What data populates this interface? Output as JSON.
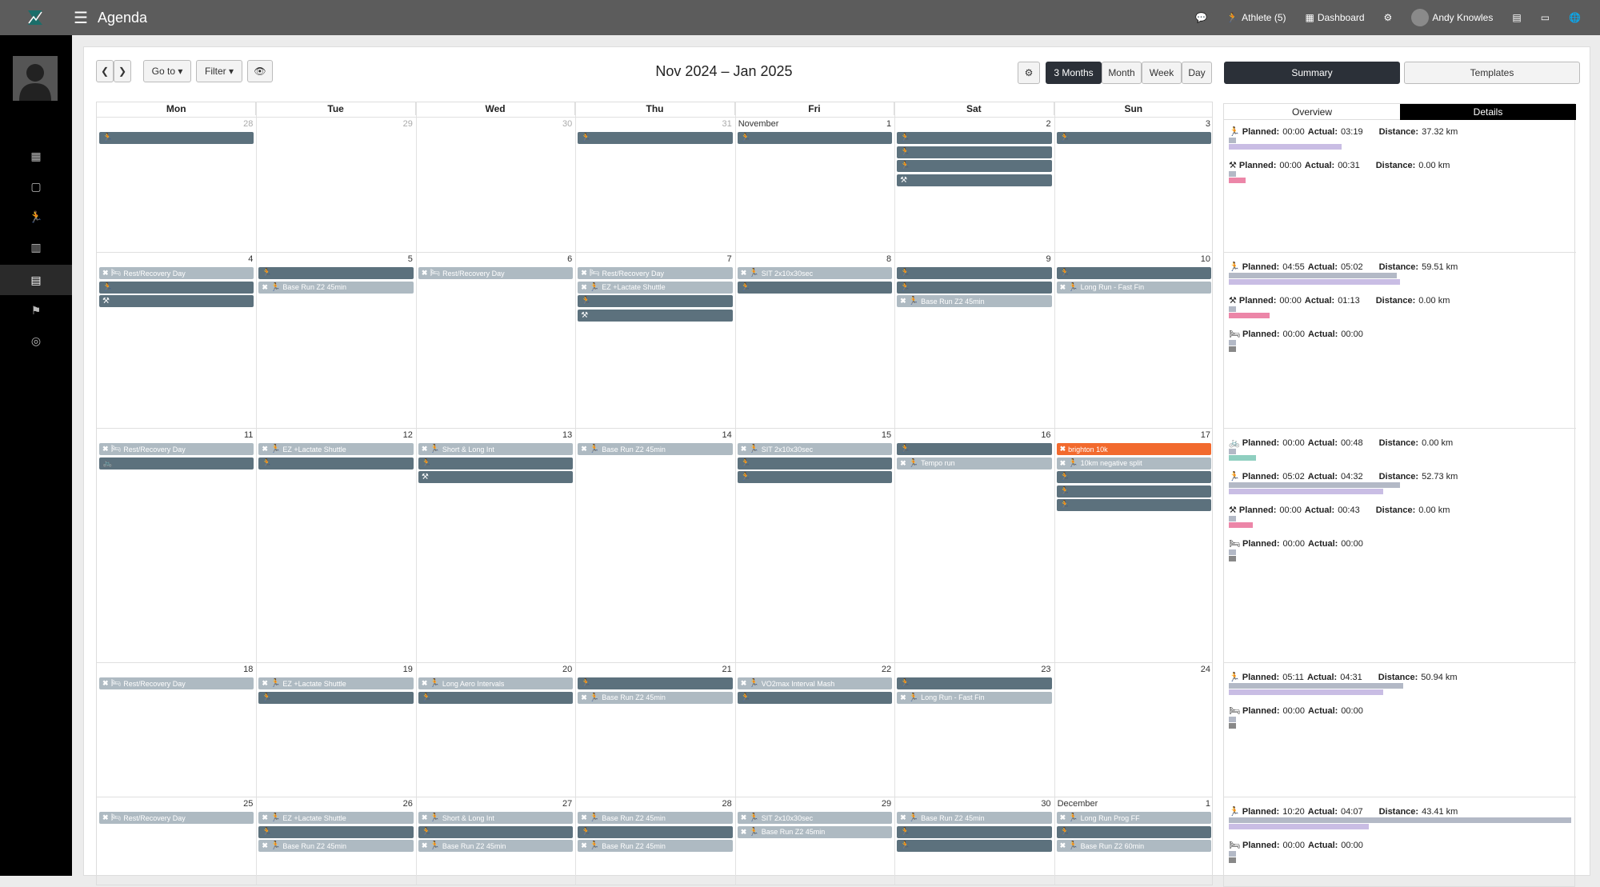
{
  "app": {
    "title": "Agenda"
  },
  "topbar": {
    "athlete": "Athlete (5)",
    "dashboard": "Dashboard",
    "user": "Andy Knowles"
  },
  "toolbar": {
    "goto": "Go to",
    "filter": "Filter",
    "title": "Nov 2024 – Jan 2025",
    "views": [
      "3 Months",
      "Month",
      "Week",
      "Day"
    ],
    "active_view": "3 Months"
  },
  "panel_tabs": {
    "summary": "Summary",
    "templates": "Templates",
    "overview": "Overview",
    "details": "Details"
  },
  "weekdays": [
    "Mon",
    "Tue",
    "Wed",
    "Thu",
    "Fri",
    "Sat",
    "Sun"
  ],
  "month_labels": {
    "nov": "November",
    "dec": "December"
  },
  "weeks": [
    {
      "days": [
        "28",
        "29",
        "30",
        "31",
        "1",
        "2",
        "3"
      ],
      "muted": [
        true,
        true,
        true,
        true,
        false,
        false,
        false
      ],
      "events": [
        {
          "col": 0,
          "row": 0,
          "style": "d",
          "icon": "run",
          "label": ""
        },
        {
          "col": 3,
          "row": 0,
          "style": "d",
          "icon": "run",
          "label": ""
        },
        {
          "col": 4,
          "row": 0,
          "style": "d",
          "icon": "run",
          "label": ""
        },
        {
          "col": 5,
          "row": 0,
          "style": "d",
          "icon": "run",
          "label": ""
        },
        {
          "col": 5,
          "row": 1,
          "style": "d",
          "icon": "run",
          "label": ""
        },
        {
          "col": 5,
          "row": 2,
          "style": "d",
          "icon": "run",
          "label": ""
        },
        {
          "col": 5,
          "row": 3,
          "style": "d",
          "icon": "strength",
          "label": ""
        },
        {
          "col": 6,
          "row": 0,
          "style": "d",
          "icon": "run",
          "label": ""
        }
      ]
    },
    {
      "days": [
        "4",
        "5",
        "6",
        "7",
        "8",
        "9",
        "10"
      ],
      "muted": [
        false,
        false,
        false,
        false,
        false,
        false,
        false
      ],
      "events": [
        {
          "col": 0,
          "row": 0,
          "style": "l",
          "icon": "rest",
          "label": "Rest/Recovery Day",
          "x": true
        },
        {
          "col": 0,
          "row": 1,
          "style": "d",
          "icon": "run",
          "label": ""
        },
        {
          "col": 0,
          "row": 2,
          "style": "d",
          "icon": "strength",
          "label": ""
        },
        {
          "col": 1,
          "row": 0,
          "style": "d",
          "icon": "run",
          "label": ""
        },
        {
          "col": 1,
          "row": 1,
          "style": "l",
          "icon": "run",
          "label": "Base Run Z2 45min",
          "x": true
        },
        {
          "col": 2,
          "row": 0,
          "style": "l",
          "icon": "rest",
          "label": "Rest/Recovery Day",
          "x": true
        },
        {
          "col": 3,
          "row": 0,
          "style": "l",
          "icon": "rest",
          "label": "Rest/Recovery Day",
          "x": true
        },
        {
          "col": 3,
          "row": 1,
          "style": "l",
          "icon": "run",
          "label": "EZ +Lactate Shuttle",
          "x": true
        },
        {
          "col": 3,
          "row": 2,
          "style": "d",
          "icon": "run",
          "label": ""
        },
        {
          "col": 3,
          "row": 3,
          "style": "d",
          "icon": "strength",
          "label": ""
        },
        {
          "col": 4,
          "row": 0,
          "style": "l",
          "icon": "run",
          "label": "SIT 2x10x30sec",
          "x": true
        },
        {
          "col": 4,
          "row": 1,
          "style": "d",
          "icon": "run",
          "label": ""
        },
        {
          "col": 5,
          "row": 0,
          "style": "d",
          "icon": "run",
          "label": ""
        },
        {
          "col": 5,
          "row": 1,
          "style": "d",
          "icon": "run",
          "label": ""
        },
        {
          "col": 5,
          "row": 2,
          "style": "l",
          "icon": "run",
          "label": "Base Run Z2 45min",
          "x": true
        },
        {
          "col": 6,
          "row": 0,
          "style": "d",
          "icon": "run",
          "label": ""
        },
        {
          "col": 6,
          "row": 1,
          "style": "l",
          "icon": "run",
          "label": "Long Run - Fast Fin",
          "x": true
        }
      ]
    },
    {
      "days": [
        "11",
        "12",
        "13",
        "14",
        "15",
        "16",
        "17"
      ],
      "muted": [
        false,
        false,
        false,
        false,
        false,
        false,
        false
      ],
      "events": [
        {
          "col": 0,
          "row": 0,
          "style": "l",
          "icon": "rest",
          "label": "Rest/Recovery Day",
          "x": true
        },
        {
          "col": 0,
          "row": 1,
          "style": "d",
          "icon": "bike",
          "label": ""
        },
        {
          "col": 1,
          "row": 0,
          "style": "l",
          "icon": "run",
          "label": "EZ +Lactate Shuttle",
          "x": true
        },
        {
          "col": 1,
          "row": 1,
          "style": "d",
          "icon": "run",
          "label": ""
        },
        {
          "col": 2,
          "row": 0,
          "style": "l",
          "icon": "run",
          "label": "Short & Long Int",
          "x": true
        },
        {
          "col": 2,
          "row": 1,
          "style": "d",
          "icon": "run",
          "label": ""
        },
        {
          "col": 2,
          "row": 2,
          "style": "d",
          "icon": "strength",
          "label": ""
        },
        {
          "col": 3,
          "row": 0,
          "style": "l",
          "icon": "run",
          "label": "Base Run Z2 45min",
          "x": true
        },
        {
          "col": 4,
          "row": 0,
          "style": "l",
          "icon": "run",
          "label": "SIT 2x10x30sec",
          "x": true
        },
        {
          "col": 4,
          "row": 1,
          "style": "d",
          "icon": "run",
          "label": ""
        },
        {
          "col": 4,
          "row": 2,
          "style": "d",
          "icon": "run",
          "label": ""
        },
        {
          "col": 5,
          "row": 0,
          "style": "d",
          "icon": "run",
          "label": ""
        },
        {
          "col": 5,
          "row": 1,
          "style": "l",
          "icon": "run",
          "label": "Tempo run",
          "x": true
        },
        {
          "col": 6,
          "row": 0,
          "style": "o",
          "icon": "",
          "label": "brighton 10k",
          "x": true
        },
        {
          "col": 6,
          "row": 1,
          "style": "l",
          "icon": "run",
          "label": "10km negative split",
          "x": true
        },
        {
          "col": 6,
          "row": 2,
          "style": "d",
          "icon": "run",
          "label": ""
        },
        {
          "col": 6,
          "row": 3,
          "style": "d",
          "icon": "run",
          "label": ""
        },
        {
          "col": 6,
          "row": 4,
          "style": "d",
          "icon": "run",
          "label": ""
        }
      ]
    },
    {
      "days": [
        "18",
        "19",
        "20",
        "21",
        "22",
        "23",
        "24"
      ],
      "muted": [
        false,
        false,
        false,
        false,
        false,
        false,
        false
      ],
      "events": [
        {
          "col": 0,
          "row": 0,
          "style": "l",
          "icon": "rest",
          "label": "Rest/Recovery Day",
          "x": true
        },
        {
          "col": 1,
          "row": 0,
          "style": "l",
          "icon": "run",
          "label": "EZ +Lactate Shuttle",
          "x": true
        },
        {
          "col": 1,
          "row": 1,
          "style": "d",
          "icon": "run",
          "label": ""
        },
        {
          "col": 2,
          "row": 0,
          "style": "l",
          "icon": "run",
          "label": "Long Aero Intervals",
          "x": true
        },
        {
          "col": 2,
          "row": 1,
          "style": "d",
          "icon": "run",
          "label": ""
        },
        {
          "col": 3,
          "row": 0,
          "style": "d",
          "icon": "run",
          "label": ""
        },
        {
          "col": 3,
          "row": 1,
          "style": "l",
          "icon": "run",
          "label": "Base Run Z2 45min",
          "x": true
        },
        {
          "col": 4,
          "row": 0,
          "style": "l",
          "icon": "run",
          "label": "VO2max Interval Mash",
          "x": true
        },
        {
          "col": 4,
          "row": 1,
          "style": "d",
          "icon": "run",
          "label": ""
        },
        {
          "col": 5,
          "row": 0,
          "style": "d",
          "icon": "run",
          "label": ""
        },
        {
          "col": 5,
          "row": 1,
          "style": "l",
          "icon": "run",
          "label": "Long Run - Fast Fin",
          "x": true
        }
      ]
    },
    {
      "days": [
        "25",
        "26",
        "27",
        "28",
        "29",
        "30",
        "1"
      ],
      "muted": [
        false,
        false,
        false,
        false,
        false,
        false,
        false
      ],
      "events": [
        {
          "col": 0,
          "row": 0,
          "style": "l",
          "icon": "rest",
          "label": "Rest/Recovery Day",
          "x": true
        },
        {
          "col": 1,
          "row": 0,
          "style": "l",
          "icon": "run",
          "label": "EZ +Lactate Shuttle",
          "x": true
        },
        {
          "col": 1,
          "row": 1,
          "style": "d",
          "icon": "run",
          "label": ""
        },
        {
          "col": 1,
          "row": 2,
          "style": "l",
          "icon": "run",
          "label": "Base Run Z2 45min",
          "x": true
        },
        {
          "col": 2,
          "row": 0,
          "style": "l",
          "icon": "run",
          "label": "Short & Long Int",
          "x": true
        },
        {
          "col": 2,
          "row": 1,
          "style": "d",
          "icon": "run",
          "label": ""
        },
        {
          "col": 2,
          "row": 2,
          "style": "l",
          "icon": "run",
          "label": "Base Run Z2 45min",
          "x": true
        },
        {
          "col": 3,
          "row": 0,
          "style": "l",
          "icon": "run",
          "label": "Base Run Z2 45min",
          "x": true
        },
        {
          "col": 3,
          "row": 1,
          "style": "d",
          "icon": "run",
          "label": ""
        },
        {
          "col": 3,
          "row": 2,
          "style": "l",
          "icon": "run",
          "label": "Base Run Z2 45min",
          "x": true
        },
        {
          "col": 4,
          "row": 0,
          "style": "l",
          "icon": "run",
          "label": "SIT 2x10x30sec",
          "x": true
        },
        {
          "col": 4,
          "row": 1,
          "style": "l",
          "icon": "run",
          "label": "Base Run Z2 45min",
          "x": true
        },
        {
          "col": 5,
          "row": 0,
          "style": "l",
          "icon": "run",
          "label": "Base Run Z2 45min",
          "x": true
        },
        {
          "col": 5,
          "row": 1,
          "style": "d",
          "icon": "run",
          "label": ""
        },
        {
          "col": 5,
          "row": 2,
          "style": "d",
          "icon": "run",
          "label": ""
        },
        {
          "col": 6,
          "row": 0,
          "style": "l",
          "icon": "run",
          "label": "Long Run Prog FF",
          "x": true
        },
        {
          "col": 6,
          "row": 1,
          "style": "d",
          "icon": "run",
          "label": ""
        },
        {
          "col": 6,
          "row": 2,
          "style": "l",
          "icon": "run",
          "label": "Base Run Z2 60min",
          "x": true
        }
      ]
    }
  ],
  "summary": [
    {
      "week": 0,
      "lines": [
        {
          "icon": "run",
          "planned": "00:00",
          "actual": "03:19",
          "distance": "37.32 km",
          "planned_frac": 0.02,
          "actual_frac": 0.33,
          "color": "#c9bde4"
        },
        {
          "icon": "strength",
          "planned": "00:00",
          "actual": "00:31",
          "distance": "0.00 km",
          "planned_frac": 0.02,
          "actual_frac": 0.05,
          "color": "#ec86a8"
        }
      ]
    },
    {
      "week": 1,
      "lines": [
        {
          "icon": "run",
          "planned": "04:55",
          "actual": "05:02",
          "distance": "59.51 km",
          "planned_frac": 0.49,
          "actual_frac": 0.5,
          "color": "#c9bde4"
        },
        {
          "icon": "strength",
          "planned": "00:00",
          "actual": "01:13",
          "distance": "0.00 km",
          "planned_frac": 0.02,
          "actual_frac": 0.12,
          "color": "#ec86a8"
        },
        {
          "icon": "rest",
          "planned": "00:00",
          "actual": "00:00",
          "distance": "",
          "planned_frac": 0.02,
          "actual_frac": 0.02,
          "color": "#888888"
        }
      ]
    },
    {
      "week": 2,
      "lines": [
        {
          "icon": "bike",
          "planned": "00:00",
          "actual": "00:48",
          "distance": "0.00 km",
          "planned_frac": 0.02,
          "actual_frac": 0.08,
          "color": "#8fcfc0"
        },
        {
          "icon": "run",
          "planned": "05:02",
          "actual": "04:32",
          "distance": "52.73 km",
          "planned_frac": 0.5,
          "actual_frac": 0.45,
          "color": "#c9bde4"
        },
        {
          "icon": "strength",
          "planned": "00:00",
          "actual": "00:43",
          "distance": "0.00 km",
          "planned_frac": 0.02,
          "actual_frac": 0.07,
          "color": "#ec86a8"
        },
        {
          "icon": "rest",
          "planned": "00:00",
          "actual": "00:00",
          "distance": "",
          "planned_frac": 0.02,
          "actual_frac": 0.02,
          "color": "#888888"
        }
      ]
    },
    {
      "week": 3,
      "lines": [
        {
          "icon": "run",
          "planned": "05:11",
          "actual": "04:31",
          "distance": "50.94 km",
          "planned_frac": 0.51,
          "actual_frac": 0.45,
          "color": "#c9bde4"
        },
        {
          "icon": "rest",
          "planned": "00:00",
          "actual": "00:00",
          "distance": "",
          "planned_frac": 0.02,
          "actual_frac": 0.02,
          "color": "#888888"
        }
      ]
    },
    {
      "week": 4,
      "lines": [
        {
          "icon": "run",
          "planned": "10:20",
          "actual": "04:07",
          "distance": "43.41 km",
          "planned_frac": 1.0,
          "actual_frac": 0.41,
          "color": "#c9bde4"
        },
        {
          "icon": "rest",
          "planned": "00:00",
          "actual": "00:00",
          "distance": "",
          "planned_frac": 0.02,
          "actual_frac": 0.02,
          "color": "#888888"
        }
      ]
    }
  ],
  "labels": {
    "planned": "Planned:",
    "actual": "Actual:",
    "distance": "Distance:"
  },
  "icons": {
    "run": "running-icon",
    "strength": "strength-icon",
    "rest": "rest-bed-icon",
    "bike": "bike-icon"
  }
}
